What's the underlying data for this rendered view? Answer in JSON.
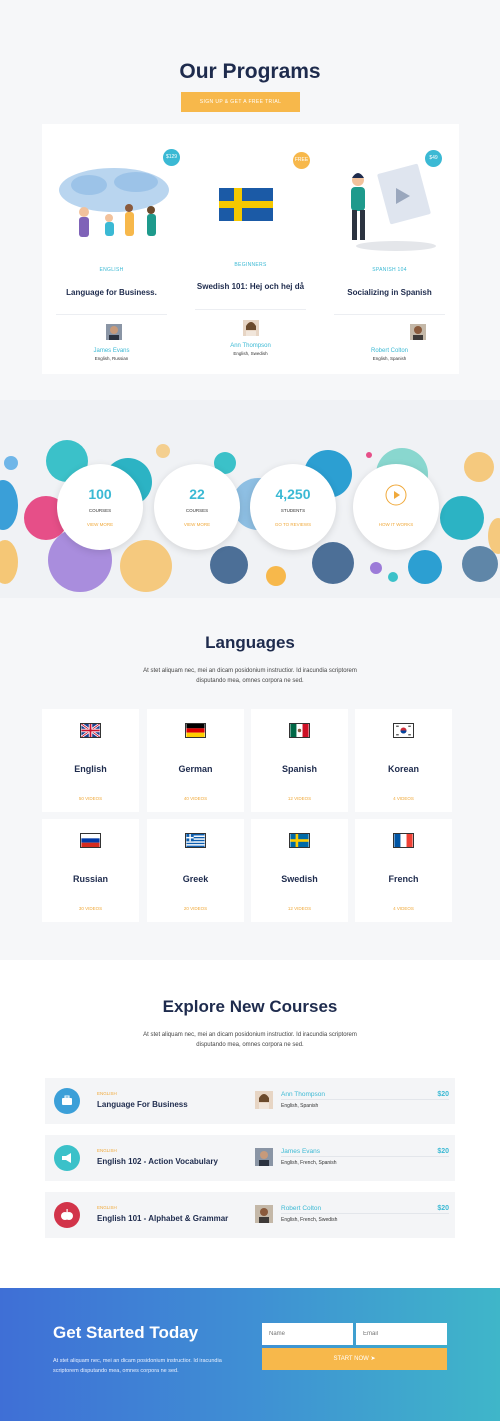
{
  "programs": {
    "title": "Our Programs",
    "cta": "SIGN UP & GET A FREE TRIAL",
    "cards": [
      {
        "price": "$129",
        "level": "ENGLISH",
        "title": "Language for Business.",
        "teacher": "James Evans",
        "languages": "English, Russian",
        "badge_color": "#3bb9d4"
      },
      {
        "price": "FREE",
        "level": "BEGINNERS",
        "title": "Swedish 101: Hej och hej då",
        "teacher": "Ann Thompson",
        "languages": "English, Swedish",
        "badge_color": "#f7b84b"
      },
      {
        "price": "$49",
        "level": "SPANISH 104",
        "title": "Socializing in Spanish",
        "teacher": "Robert Colton",
        "languages": "English, Spanish",
        "badge_color": "#3bb9d4"
      }
    ]
  },
  "stats": {
    "items": [
      {
        "number": "100",
        "label": "COURSES",
        "link": "VIEW MORE"
      },
      {
        "number": "22",
        "label": "COURSES",
        "link": "VIEW MORE"
      },
      {
        "number": "4,250",
        "label": "STUDENTS",
        "link": "GO TO REVIEWS"
      },
      {
        "number": "",
        "label": "",
        "link": "HOW IT WORKS"
      }
    ]
  },
  "languages": {
    "title": "Languages",
    "description": "At stet aliquam nec, mei an dicam posidonium instructior. Id iracundia scriptorem disputando mea, omnes corpora ne sed.",
    "items": [
      {
        "name": "English",
        "videos": "50 VIDEOS"
      },
      {
        "name": "German",
        "videos": "40 VIDEOS"
      },
      {
        "name": "Spanish",
        "videos": "12 VIDEOS"
      },
      {
        "name": "Korean",
        "videos": "4 VIDEOS"
      },
      {
        "name": "Russian",
        "videos": "30 VIDEOS"
      },
      {
        "name": "Greek",
        "videos": "20 VIDEOS"
      },
      {
        "name": "Swedish",
        "videos": "12 VIDEOS"
      },
      {
        "name": "French",
        "videos": "4 VIDEOS"
      }
    ]
  },
  "courses": {
    "title": "Explore New Courses",
    "description": "At stet aliquam nec, mei an dicam posidonium instructior. Id iracundia scriptorem disputando mea, omnes corpora ne sed.",
    "items": [
      {
        "level": "ENGLISH",
        "title": "Language For Business",
        "teacher": "Ann Thompson",
        "languages": "English, Spanish",
        "price": "$20",
        "icon": "briefcase-icon",
        "color": "#3b9fd8"
      },
      {
        "level": "ENGLISH",
        "title": "English 102 - Action Vocabulary",
        "teacher": "James Evans",
        "languages": "English, French, Spanish",
        "price": "$20",
        "icon": "megaphone-icon",
        "color": "#3bc1c9"
      },
      {
        "level": "ENGLISH",
        "title": "English 101 - Alphabet & Grammar",
        "teacher": "Robert Colton",
        "languages": "English, French, Swedish",
        "price": "$20",
        "icon": "apple-icon",
        "color": "#d2344a"
      }
    ]
  },
  "get_started": {
    "title": "Get Started Today",
    "description": "At stet aliquam nec, mei an dicam posidonium instructior. Id iracundia scriptorem disputando mea, omnes corpora ne sed.",
    "name_placeholder": "Name",
    "email_placeholder": "Email",
    "button": "START NOW"
  }
}
